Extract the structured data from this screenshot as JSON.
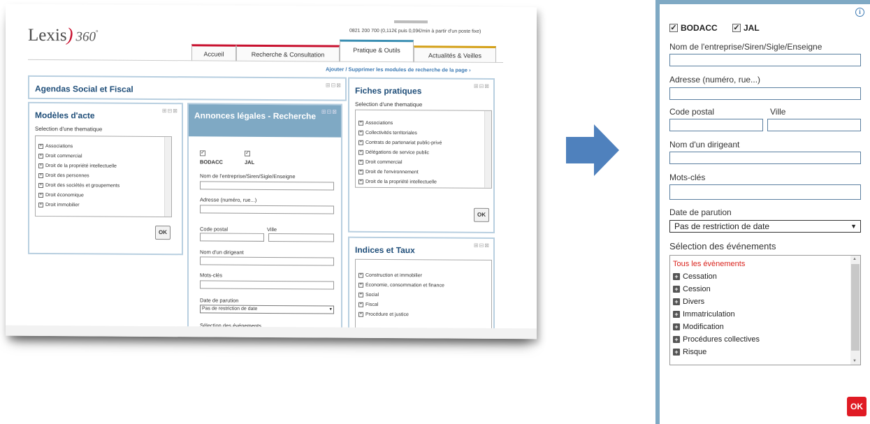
{
  "screenshot": {
    "logo_text": "Lexis",
    "logo_number": "360",
    "logo_mark": "°",
    "phone": "0821 200 700 (0,112€ puis 0,09€/min à partir d'un poste fixe)",
    "tabs": [
      "Accueil",
      "Recherche & Consultation",
      "Pratique & Outils",
      "Actualités & Veilles"
    ],
    "ajouter_link": "Ajouter / Supprimer les modules de recherche de la page ›",
    "agendas": {
      "title": "Agendas Social et Fiscal"
    },
    "modeles": {
      "title": "Modèles d'acte",
      "subtitle": "Selection d'une thematique",
      "items": [
        "Associations",
        "Droit commercial",
        "Droit de la propriété intellectuelle",
        "Droit des personnes",
        "Droit des sociétés et groupements",
        "Droit économique",
        "Droit immobilier"
      ],
      "ok": "OK"
    },
    "annonces": {
      "title": "Annonces légales - Recherche",
      "bodacc": "BODACC",
      "jal": "JAL",
      "nom": "Nom de l'entreprise/Siren/Sigle/Enseigne",
      "adresse": "Adresse (numéro, rue...)",
      "cp": "Code postal",
      "ville": "Ville",
      "dirigeant": "Nom d'un dirigeant",
      "mots": "Mots-clés",
      "date": "Date de parution",
      "date_value": "Pas de restriction de date",
      "evenements": "Sélection des événements"
    },
    "fiches": {
      "title": "Fiches pratiques",
      "subtitle": "Selection d'une thematique",
      "items": [
        "Associations",
        "Collectivités territoriales",
        "Contrats de partenariat public-privé",
        "Délégations de service public",
        "Droit commercial",
        "Droit de l'environnement",
        "Droit de la propriété intellectuelle"
      ],
      "ok": "OK"
    },
    "indices": {
      "title": "Indices et Taux",
      "items": [
        "Construction et immobilier",
        "Économie, consommation et finance",
        "Social",
        "Fiscal",
        "Procédure et justice"
      ]
    }
  },
  "panel": {
    "bodacc": "BODACC",
    "jal": "JAL",
    "nom_label": "Nom de l'entreprise/Siren/Sigle/Enseigne",
    "adresse_label": "Adresse (numéro, rue...)",
    "cp_label": "Code postal",
    "ville_label": "Ville",
    "dirigeant_label": "Nom d'un dirigeant",
    "mots_label": "Mots-clés",
    "date_label": "Date de parution",
    "date_value": "Pas de restriction de date",
    "evenements_label": "Sélection des événements",
    "ev_all": "Tous les évènements",
    "events": [
      "Cessation",
      "Cession",
      "Divers",
      "Immatriculation",
      "Modification",
      "Procédures collectives",
      "Risque"
    ],
    "ok": "OK"
  },
  "colors": {
    "accent": "#7fa9c4",
    "red": "#e01b24",
    "link": "#3b79b3"
  }
}
